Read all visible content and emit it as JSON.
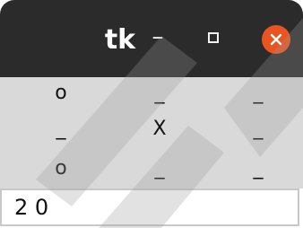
{
  "window": {
    "title": "tk",
    "minimize_glyph": "–",
    "maximize_icon": "square-icon",
    "close_icon": "x-icon",
    "close_color": "#e95420"
  },
  "board": {
    "cells": [
      {
        "row": 0,
        "col": 0,
        "text": "o"
      },
      {
        "row": 0,
        "col": 1,
        "text": "_"
      },
      {
        "row": 0,
        "col": 2,
        "text": "_"
      },
      {
        "row": 1,
        "col": 0,
        "text": "_"
      },
      {
        "row": 1,
        "col": 1,
        "text": "X"
      },
      {
        "row": 1,
        "col": 2,
        "text": "_"
      },
      {
        "row": 2,
        "col": 0,
        "text": "o"
      },
      {
        "row": 2,
        "col": 1,
        "text": "_"
      },
      {
        "row": 2,
        "col": 2,
        "text": "_"
      }
    ]
  },
  "entry": {
    "value": "2 0"
  }
}
